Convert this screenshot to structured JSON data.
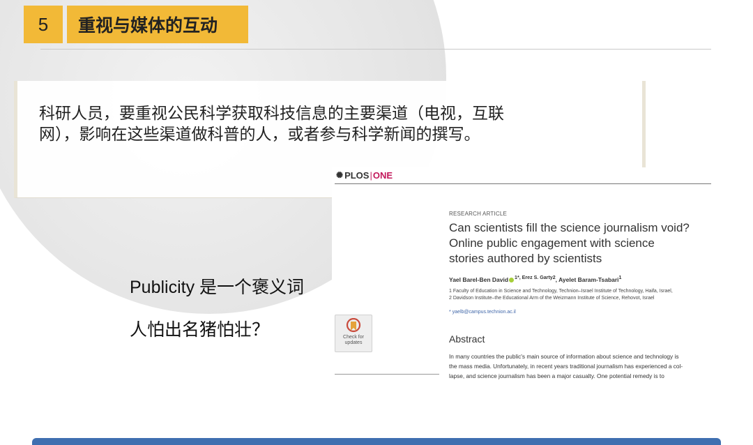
{
  "header": {
    "section_number": "5",
    "section_title": "重视与媒体的互动"
  },
  "quote": {
    "text_line1": "科研人员，要重视公民科学获取科技信息的主要渠道（电视，互联",
    "text_line2": "网），影响在这些渠道做科普的人，或者参与科学新闻的撰写。"
  },
  "points": [
    {
      "text": "Publicity 是一个褒义词"
    },
    {
      "text": "人怕出名猪怕壮？"
    }
  ],
  "paper": {
    "journal_logo_prefix": "PLOS",
    "journal_logo_suffix": "ONE",
    "article_type": "RESEARCH ARTICLE",
    "title_line1": "Can scientists fill the science journalism void?",
    "title_line2": "Online public engagement with science",
    "title_line3": "stories authored by scientists",
    "authors": "Yael Barel-Ben David",
    "authors_marks": "1*, Erez S. Garty",
    "authors_mark2": "2",
    "authors_rest": ", Ayelet Baram-Tsabari",
    "authors_mark3": "1",
    "affiliation1": "1  Faculty of Education in Science and Technology, Technion–Israel Institute of Technology, Haifa, Israel,",
    "affiliation2": "2  Davidson Institute–the Educational Arm of the Weizmann Institute of Science, Rehovot, Israel",
    "email": "* yaelb@campus.technion.ac.il",
    "badge_text": "Check for updates",
    "abstract_heading": "Abstract",
    "abstract_line1": "In many countries the public's main source of information about science and technology is",
    "abstract_line2": "the mass media. Unfortunately, in recent years traditional journalism has experienced a col-",
    "abstract_line3": "lapse, and science journalism has been a major casualty. One potential remedy is to"
  },
  "colors": {
    "accent": "#f2b937",
    "plos_pink": "#c2185b",
    "footer_blue": "#3f6fb0"
  }
}
